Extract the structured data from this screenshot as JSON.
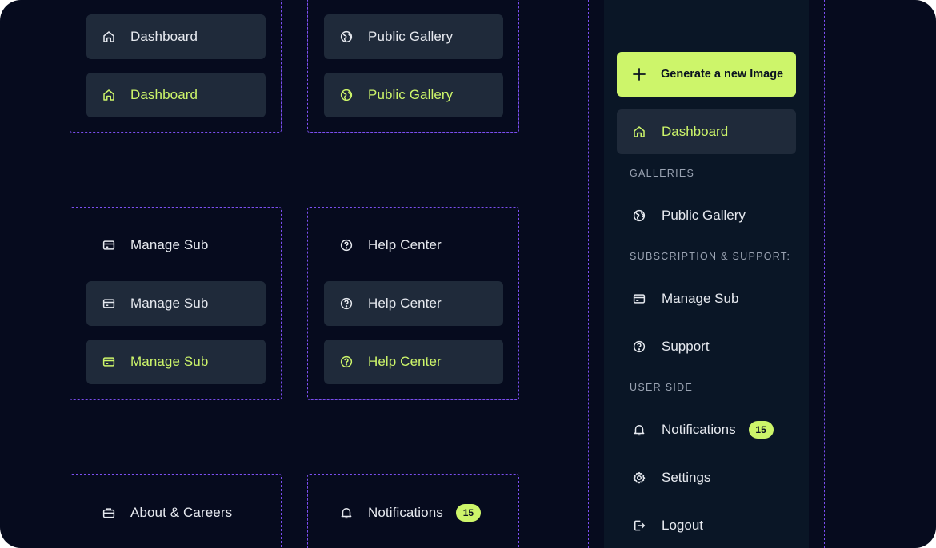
{
  "colors": {
    "background": "#060b1e",
    "item_bg": "#1f2a3a",
    "accent": "#cdf56a",
    "text": "#e6e9ef",
    "guide": "#7b4ef0",
    "sidebar_bg": "#0a1626"
  },
  "variants": {
    "dashboard": [
      {
        "label": "Dashboard",
        "icon": "home-icon",
        "state": "default"
      },
      {
        "label": "Dashboard",
        "icon": "home-icon",
        "state": "active"
      }
    ],
    "public_gallery": [
      {
        "label": "Public Gallery",
        "icon": "globe-icon",
        "state": "default"
      },
      {
        "label": "Public Gallery",
        "icon": "globe-icon",
        "state": "active"
      }
    ],
    "manage_sub": [
      {
        "label": "Manage Sub",
        "icon": "credit-card-icon",
        "state": "plain"
      },
      {
        "label": "Manage Sub",
        "icon": "credit-card-icon",
        "state": "default"
      },
      {
        "label": "Manage Sub",
        "icon": "credit-card-icon",
        "state": "active"
      }
    ],
    "help_center": [
      {
        "label": "Help Center",
        "icon": "help-circle-icon",
        "state": "plain"
      },
      {
        "label": "Help Center",
        "icon": "help-circle-icon",
        "state": "default"
      },
      {
        "label": "Help Center",
        "icon": "help-circle-icon",
        "state": "active"
      }
    ],
    "about": [
      {
        "label": "About & Careers",
        "icon": "briefcase-icon",
        "state": "plain"
      }
    ],
    "notifications": [
      {
        "label": "Notifications",
        "icon": "bell-icon",
        "state": "plain",
        "badge": "15"
      }
    ]
  },
  "sidebar": {
    "generate_button": {
      "label": "Generate a new Image",
      "icon": "plus-icon"
    },
    "dashboard": {
      "label": "Dashboard",
      "icon": "home-icon"
    },
    "sections": {
      "galleries": "GALLERIES",
      "subscription": "SUBSCRIPTION & SUPPORT:",
      "user_side": "USER SIDE"
    },
    "items": {
      "public_gallery": {
        "label": "Public Gallery",
        "icon": "globe-icon"
      },
      "manage_sub": {
        "label": "Manage Sub",
        "icon": "credit-card-icon"
      },
      "support": {
        "label": "Support",
        "icon": "help-circle-icon"
      },
      "notifications": {
        "label": "Notifications",
        "icon": "bell-icon",
        "badge": "15"
      },
      "settings": {
        "label": "Settings",
        "icon": "gear-icon"
      },
      "logout": {
        "label": "Logout",
        "icon": "logout-icon"
      }
    }
  }
}
